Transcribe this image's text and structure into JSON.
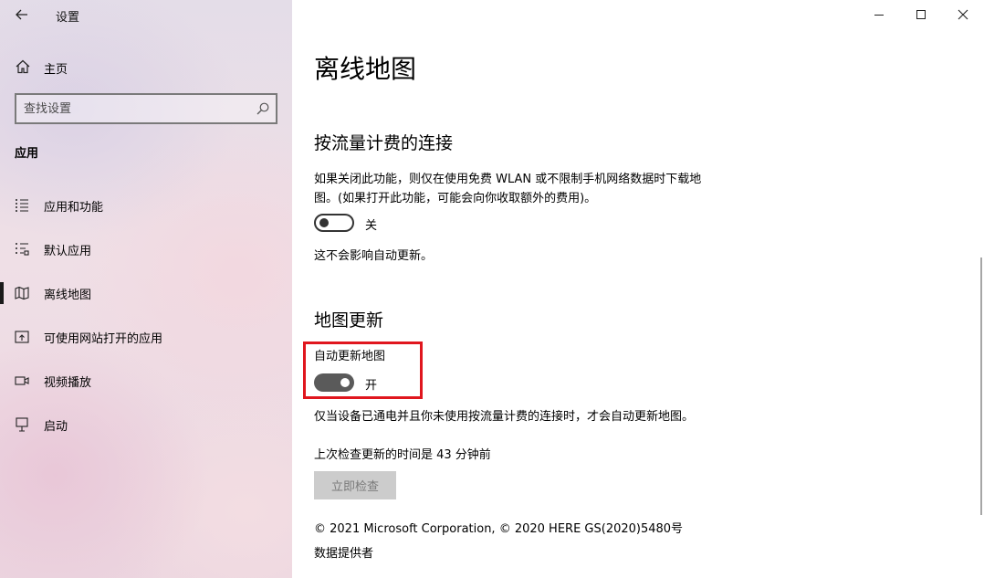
{
  "window": {
    "title": "设置"
  },
  "sidebar": {
    "home_label": "主页",
    "search": {
      "placeholder": "查找设置",
      "value": ""
    },
    "section_heading": "应用",
    "items": [
      {
        "label": "应用和功能",
        "icon": "list-icon",
        "active": false
      },
      {
        "label": "默认应用",
        "icon": "default-apps-icon",
        "active": false
      },
      {
        "label": "离线地图",
        "icon": "map-icon",
        "active": true
      },
      {
        "label": "可使用网站打开的应用",
        "icon": "open-website-icon",
        "active": false
      },
      {
        "label": "视频播放",
        "icon": "video-icon",
        "active": false
      },
      {
        "label": "启动",
        "icon": "startup-icon",
        "active": false
      }
    ]
  },
  "main": {
    "title": "离线地图",
    "metered": {
      "heading": "按流量计费的连接",
      "description": "如果关闭此功能，则仅在使用免费 WLAN 或不限制手机网络数据时下载地图。(如果打开此功能，可能会向你收取额外的费用)。",
      "toggle_state": "关",
      "note": "这不会影响自动更新。"
    },
    "updates": {
      "heading": "地图更新",
      "auto_update_label": "自动更新地图",
      "toggle_state": "开",
      "description": "仅当设备已通电并且你未使用按流量计费的连接时，才会自动更新地图。",
      "last_check": "上次检查更新的时间是 43 分钟前",
      "check_button": "立即检查"
    },
    "copyright": "© 2021 Microsoft Corporation, © 2020 HERE GS(2020)5480号",
    "data_providers": "数据提供者"
  },
  "colors": {
    "highlight": "#e0161e",
    "toggle_on": "#5a5a5a",
    "button_disabled": "#cccccc"
  }
}
